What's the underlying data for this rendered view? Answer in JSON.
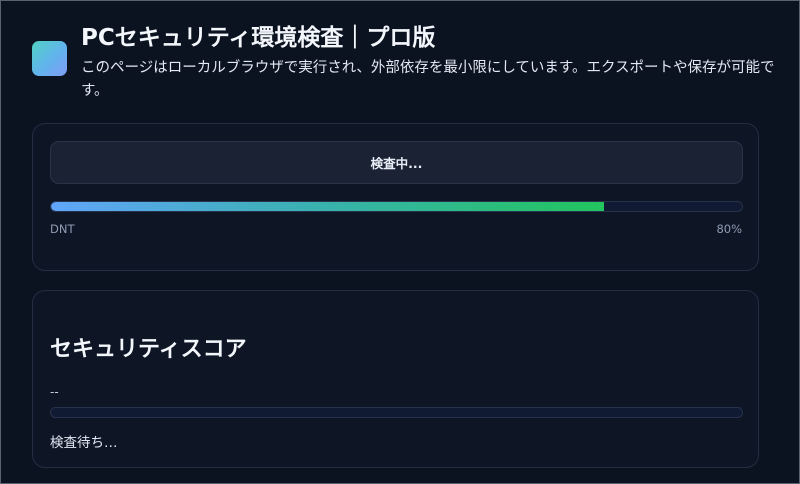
{
  "header": {
    "logo_icon": "app-logo-icon",
    "title": "PCセキュリティ環境検査｜プロ版",
    "subtitle": "このページはローカルブラウザで実行され、外部依存を最小限にしています。エクスポートや保存が可能です。"
  },
  "scan": {
    "button_label": "検査中...",
    "progress_label": "DNT",
    "progress_percent_text": "80%",
    "progress_percent": 80,
    "accent_start": "#60a5fa",
    "accent_end": "#22c55e"
  },
  "score": {
    "heading": "セキュリティスコア",
    "value": "--",
    "progress_percent": 0,
    "status": "検査待ち…"
  },
  "colors": {
    "background": "#0b1220",
    "card": "#0e1626",
    "track": "#111a33"
  }
}
